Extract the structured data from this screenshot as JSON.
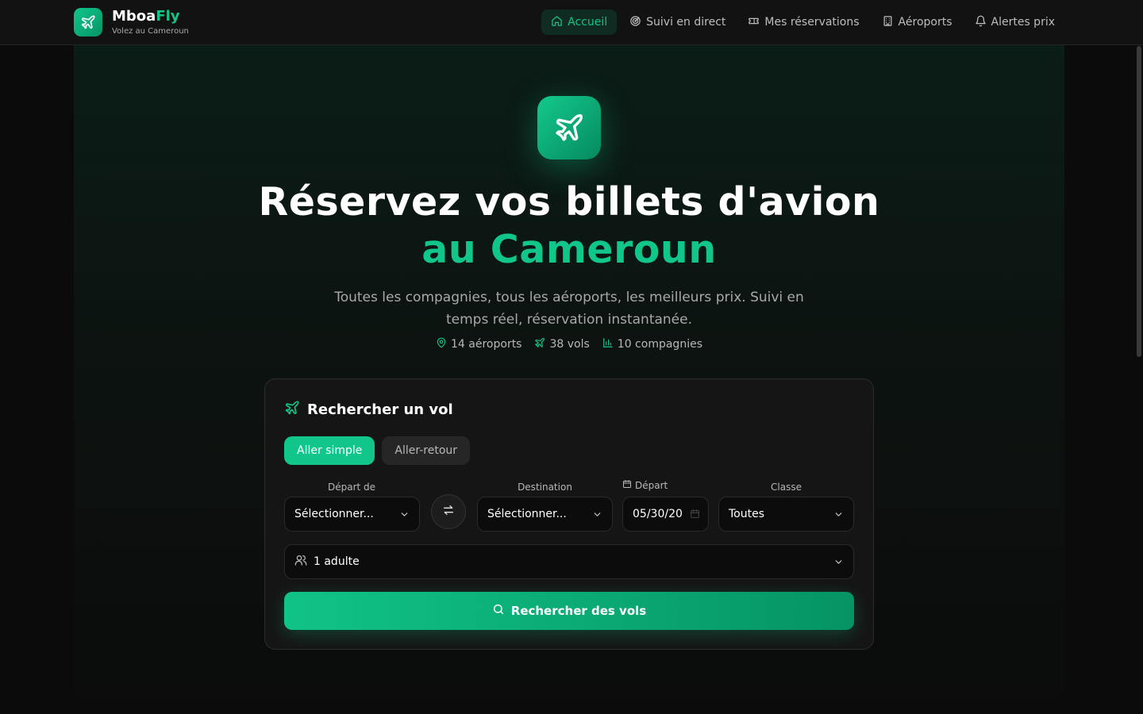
{
  "brand": {
    "name_main": "Mboa",
    "name_accent": "Fly",
    "tagline": "Volez au Cameroun"
  },
  "nav": {
    "items": [
      {
        "label": "Accueil",
        "icon": "home-icon",
        "active": true
      },
      {
        "label": "Suivi en direct",
        "icon": "radar-icon"
      },
      {
        "label": "Mes réservations",
        "icon": "ticket-icon"
      },
      {
        "label": "Aéroports",
        "icon": "building-icon"
      },
      {
        "label": "Alertes prix",
        "icon": "bell-icon"
      }
    ]
  },
  "hero": {
    "title_line1": "Réservez vos billets d'avion",
    "title_line2": "au Cameroun",
    "subtitle": "Toutes les compagnies, tous les aéroports, les meilleurs prix. Suivi en temps réel, réservation instantanée.",
    "stats": {
      "airports": "14 aéroports",
      "flights": "38 vols",
      "airlines": "10 compagnies"
    }
  },
  "search": {
    "title": "Rechercher un vol",
    "trip_types": {
      "one_way": "Aller simple",
      "round_trip": "Aller-retour"
    },
    "from_label": "Départ de",
    "from_value": "Sélectionner...",
    "to_label": "Destination",
    "to_value": "Sélectionner...",
    "date_label": "Départ",
    "date_value": "05/30/20",
    "class_label": "Classe",
    "class_value": "Toutes",
    "passengers_value": "1 adulte",
    "submit_label": "Rechercher des vols"
  },
  "colors": {
    "accent": "#10c68a",
    "background": "#0b0b0b",
    "card": "#151515"
  }
}
